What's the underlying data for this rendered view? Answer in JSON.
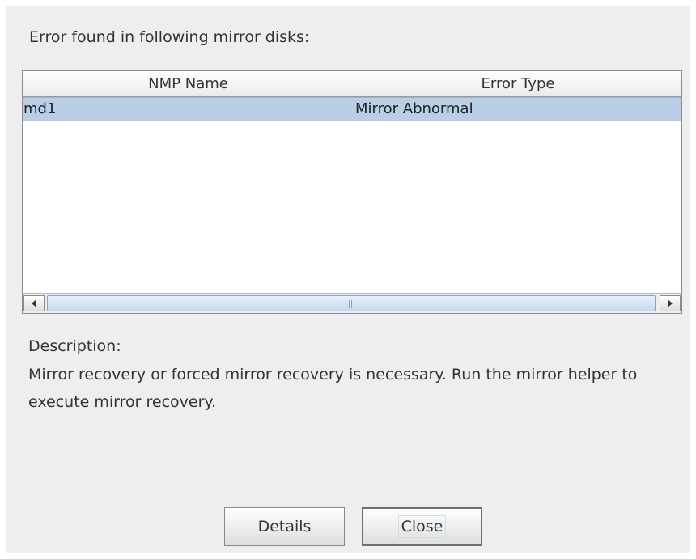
{
  "dialog": {
    "heading": "Error found in following mirror disks:"
  },
  "table": {
    "columns": [
      "NMP Name",
      "Error Type"
    ],
    "rows": [
      {
        "nmp_name": "md1",
        "error_type": "Mirror Abnormal",
        "selected": true
      }
    ],
    "selection_color": "#b8cfe5"
  },
  "description": {
    "label": "Description:",
    "text": "Mirror recovery or forced mirror recovery is necessary. Run the mirror helper to execute mirror recovery."
  },
  "buttons": {
    "details_label": "Details",
    "close_label": "Close"
  },
  "icons": {
    "scroll_left": "arrow-left-icon",
    "scroll_right": "arrow-right-icon"
  }
}
